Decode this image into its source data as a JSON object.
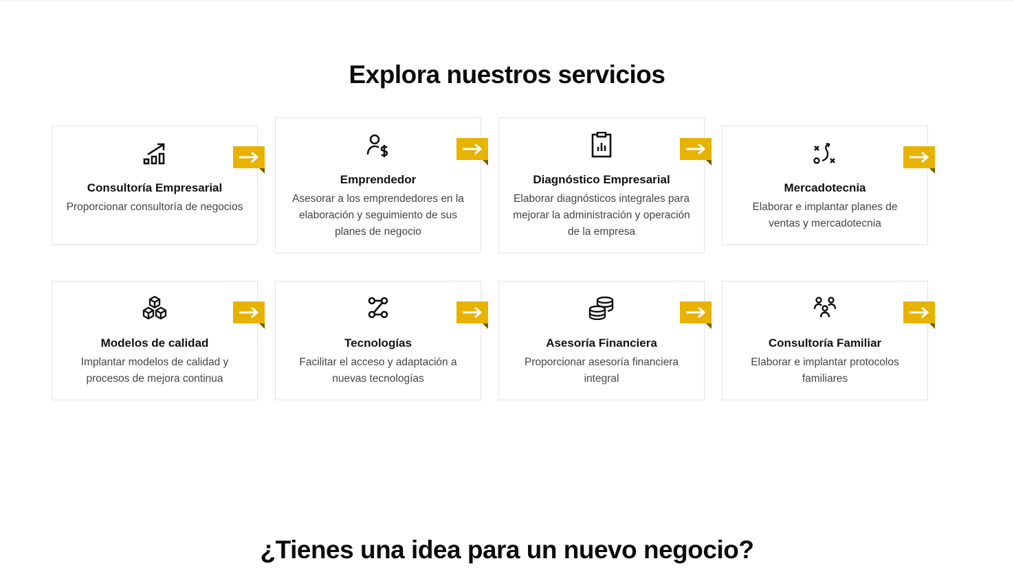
{
  "services_title": "Explora nuestros servicios",
  "cta_title": "¿Tienes una idea para un nuevo negocio?",
  "accent_color": "#e8b200",
  "cards": [
    {
      "icon": "chart-growth-icon",
      "title": "Consultoría Empresarial",
      "desc": "Proporcionar consultoría de negocios"
    },
    {
      "icon": "user-dollar-icon",
      "title": "Emprendedor",
      "desc": "Asesorar a los emprendedores en la elaboración y seguimiento de sus planes de negocio"
    },
    {
      "icon": "clipboard-chart-icon",
      "title": "Diagnóstico Empresarial",
      "desc": "Elaborar diagnósticos integrales para mejorar la administración y operación de la empresa"
    },
    {
      "icon": "strategy-play-icon",
      "title": "Mercadotecnia",
      "desc": "Elaborar e implantar planes de ventas y mercadotecnia"
    },
    {
      "icon": "cubes-icon",
      "title": "Modelos de calidad",
      "desc": "Implantar modelos de calidad y procesos de mejora continua"
    },
    {
      "icon": "route-icon",
      "title": "Tecnologías",
      "desc": "Facilitar el acceso y adaptación a nuevas tecnologías"
    },
    {
      "icon": "coins-stack-icon",
      "title": "Asesoría Financiera",
      "desc": "Proporcionar asesoría financiera integral"
    },
    {
      "icon": "family-icon",
      "title": "Consultoría Familiar",
      "desc": "Elaborar e implantar protocolos familiares"
    }
  ]
}
